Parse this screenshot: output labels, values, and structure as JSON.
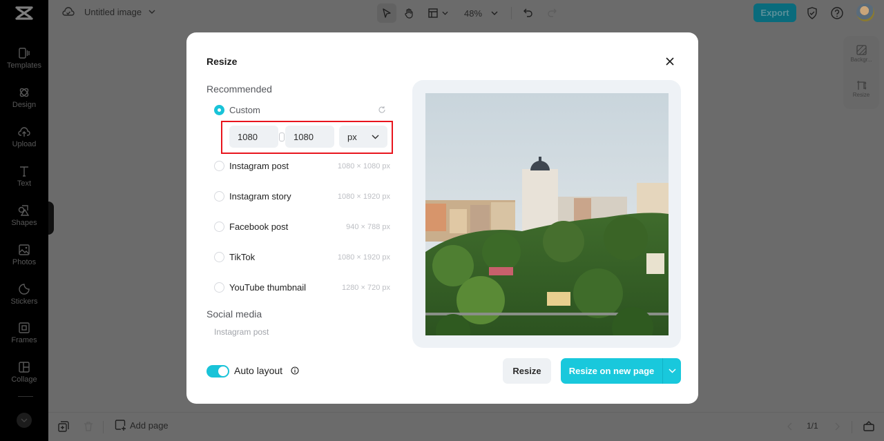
{
  "app": {
    "doc_title": "Untitled image",
    "zoom_level": "48%",
    "export_label": "Export"
  },
  "sidebar": {
    "items": [
      {
        "label": "Templates",
        "icon": "templates-icon"
      },
      {
        "label": "Design",
        "icon": "design-icon"
      },
      {
        "label": "Upload",
        "icon": "upload-icon"
      },
      {
        "label": "Text",
        "icon": "text-icon"
      },
      {
        "label": "Shapes",
        "icon": "shapes-icon"
      },
      {
        "label": "Photos",
        "icon": "photos-icon"
      },
      {
        "label": "Stickers",
        "icon": "stickers-icon"
      },
      {
        "label": "Frames",
        "icon": "frames-icon"
      },
      {
        "label": "Collage",
        "icon": "collage-icon"
      }
    ]
  },
  "right_panel": {
    "items": [
      {
        "label": "Backgr...",
        "icon": "background-icon"
      },
      {
        "label": "Resize",
        "icon": "resize-icon"
      }
    ]
  },
  "bottom_bar": {
    "add_page_label": "Add page",
    "page_indicator": "1/1"
  },
  "modal": {
    "title": "Resize",
    "recommended_title": "Recommended",
    "custom": {
      "label": "Custom",
      "selected": true,
      "width": "1080",
      "height": "1080",
      "unit": "px"
    },
    "options": [
      {
        "label": "Instagram post",
        "size": "1080 × 1080 px"
      },
      {
        "label": "Instagram story",
        "size": "1080 × 1920 px"
      },
      {
        "label": "Facebook post",
        "size": "940 × 788 px"
      },
      {
        "label": "TikTok",
        "size": "1080 × 1920 px"
      },
      {
        "label": "YouTube thumbnail",
        "size": "1280 × 720 px"
      }
    ],
    "social_title": "Social media",
    "social_items": [
      "Instagram post"
    ],
    "auto_layout_label": "Auto layout",
    "auto_layout_on": true,
    "resize_label": "Resize",
    "resize_new_page_label": "Resize on new page",
    "accent_color": "#19c8dc"
  }
}
